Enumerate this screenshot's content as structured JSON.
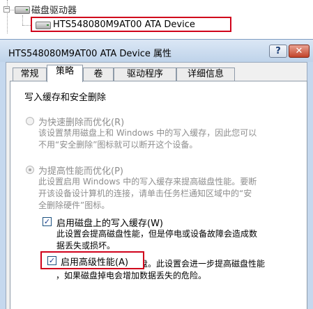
{
  "tree": {
    "category_label": "磁盘驱动器",
    "device_label": "HTS548080M9AT00 ATA Device",
    "expander_glyph": "−"
  },
  "window": {
    "title": "HTS548080M9AT00 ATA Device 属性",
    "help_glyph": "?",
    "close_glyph": "✕",
    "tabs": [
      {
        "label": "常规",
        "active": false
      },
      {
        "label": "策略",
        "active": true
      },
      {
        "label": "卷",
        "active": false
      },
      {
        "label": "驱动程序",
        "active": false
      },
      {
        "label": "详细信息",
        "active": false
      }
    ]
  },
  "policy": {
    "group_title": "写入缓存和安全删除",
    "quick_removal": {
      "label": "为快速删除而优化(R)",
      "desc_1": "该设置禁用磁盘上和 Windows 中的写入缓存，因此您可以",
      "desc_2": "不用“安全删除”图标就可以断开这个设备。",
      "selected": false
    },
    "better_performance": {
      "label": "为提高性能而优化(P)",
      "desc_1": "此设置启用 Windows 中的写入缓存来提高磁盘性能。要断",
      "desc_2": "开该设备设计算机的连接，请单击任务栏通知区域中的“安",
      "desc_3": "全删除硬件”图标。",
      "selected": true
    },
    "write_cache": {
      "label": "启用磁盘上的写入缓存(W)",
      "desc_1": "此设置会提高磁盘性能，但是停电或设备故障会造成数",
      "desc_2": "据丢失或损坏。",
      "checked": true
    },
    "advanced_performance": {
      "label": "启用高级性能(A)",
      "desc_1": "只适合有备用电源的磁盘。此设置会进一步提高磁盘性能",
      "desc_2": "，如果磁盘掉电会增加数据丢失的危险。",
      "checked": true
    }
  },
  "colors": {
    "highlight_red": "#d0021b",
    "window_frame": "#c5d8ee",
    "disabled_text": "#8d8d8d"
  },
  "icons": {
    "drive": "drive-icon",
    "check": "✓"
  }
}
